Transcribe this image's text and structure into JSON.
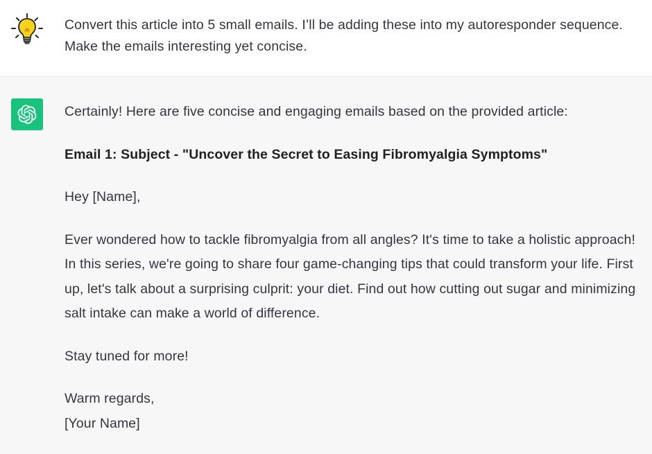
{
  "user_message": {
    "avatar_icon": "lightbulb-icon",
    "text": "Convert this article into 5 small emails. I’ll be adding these into my autoresponder sequence. Make the emails interesting yet concise."
  },
  "assistant_message": {
    "avatar_icon": "openai-logo-icon",
    "avatar_color": "#19c37d",
    "intro": "Certainly! Here are five concise and engaging emails based on the provided article:",
    "email_heading": "Email 1: Subject - \"Uncover the Secret to Easing Fibromyalgia Symptoms\"",
    "greeting": "Hey [Name],",
    "body": "Ever wondered how to tackle fibromyalgia from all angles? It's time to take a holistic approach! In this series, we're going to share four game-changing tips that could transform your life. First up, let's talk about a surprising culprit: your diet. Find out how cutting out sugar and minimizing salt intake can make a world of difference.",
    "closing_line": "Stay tuned for more!",
    "signoff": "Warm regards,",
    "signature": "[Your Name]"
  }
}
